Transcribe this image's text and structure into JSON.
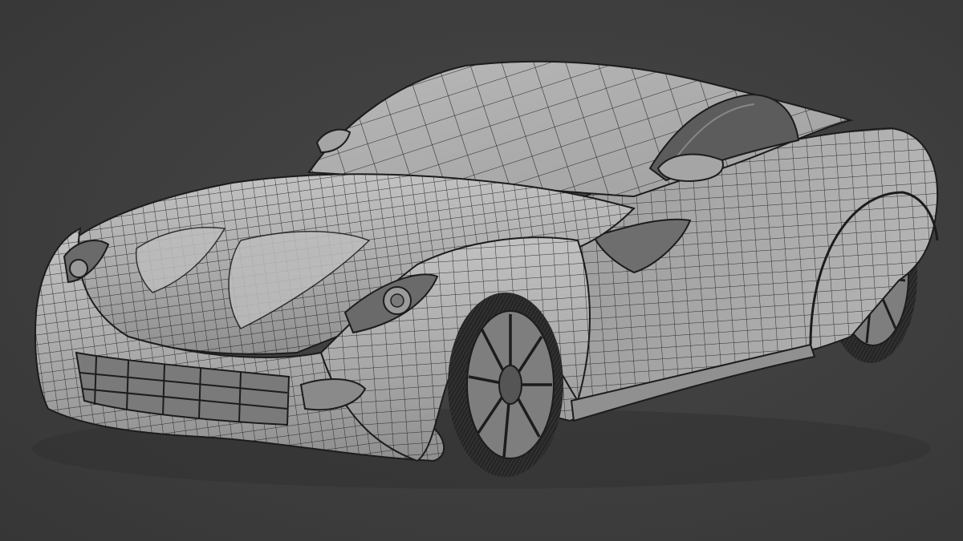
{
  "scene": {
    "subject": "car-wireframe",
    "colors": {
      "background": "#3d3d3d",
      "body": "#a8a8a8",
      "body_shadow": "#8a8a8a",
      "body_highlight": "#c4c4c4",
      "wire": "#1c1c1c",
      "tire": "#2a2a2a",
      "rim": "#9a9a9a"
    }
  }
}
